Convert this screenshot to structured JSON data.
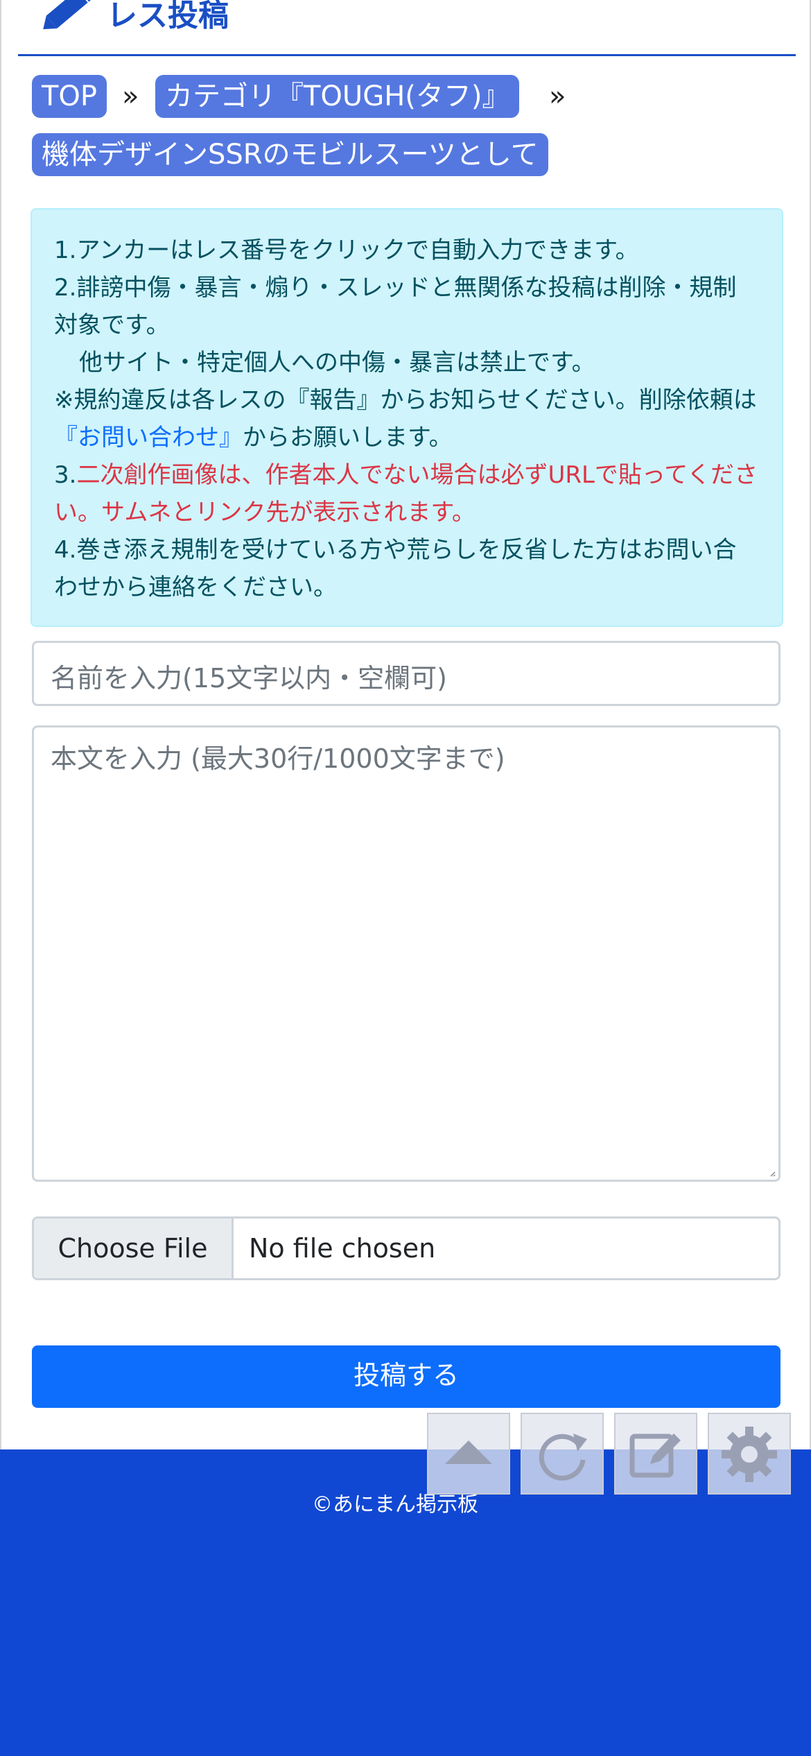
{
  "header": {
    "title": "レス投稿"
  },
  "breadcrumb": {
    "items": [
      "TOP",
      "カテゴリ『TOUGH(タフ)』",
      "機体デザインSSRのモビルスーツとして"
    ],
    "separator": "»"
  },
  "notice": {
    "line1": "1.アンカーはレス番号をクリックで自動入力できます。",
    "line2": "2.誹謗中傷・暴言・煽り・スレッドと無関係な投稿は削除・規制対象です。",
    "line3": "他サイト・特定個人への中傷・暴言は禁止です。",
    "line4_pre": "※規約違反は各レスの『報告』からお知らせください。削除依頼は",
    "line4_link": "『お問い合わせ』",
    "line4_post": "からお願いします。",
    "line5_prefix": "3.",
    "line5_red": "二次創作画像は、作者本人でない場合は必ずURLで貼ってください。サムネとリンク先が表示されます。",
    "line6": "4.巻き添え規制を受けている方や荒らしを反省した方はお問い合わせから連絡をください。"
  },
  "form": {
    "name_placeholder": "名前を入力(15文字以内・空欄可)",
    "body_placeholder": "本文を入力 (最大30行/1000文字まで)",
    "file_button": "Choose File",
    "file_status": "No file chosen",
    "submit_label": "投稿する"
  },
  "footer": {
    "copyright": "©あにまん掲示板"
  },
  "fabs": [
    "scroll-top-icon",
    "reload-icon",
    "compose-icon",
    "settings-gear-icon"
  ],
  "colors": {
    "brand_blue": "#1a4fc4",
    "crumb_bg": "#5578e0",
    "notice_bg": "#cff4fc",
    "notice_text": "#055160",
    "warning_red": "#dc3545",
    "link_blue": "#0d6efd",
    "submit_bg": "#0d6efd",
    "footer_bg": "#1148d3"
  }
}
